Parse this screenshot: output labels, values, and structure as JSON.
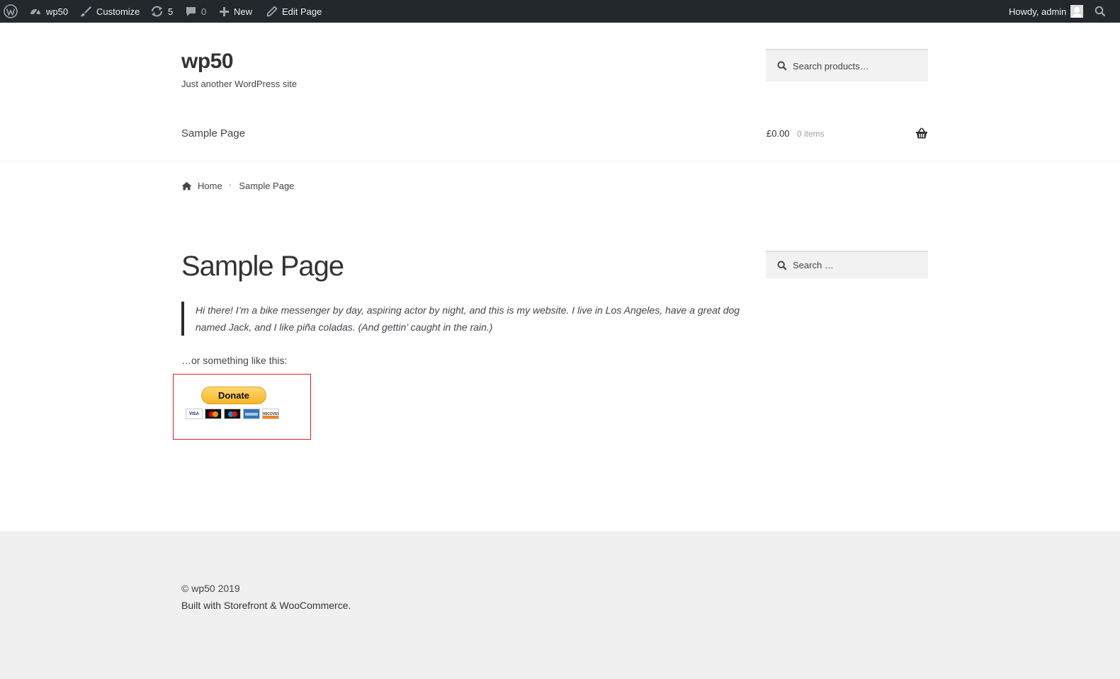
{
  "admin_bar": {
    "site_name": "wp50",
    "customize": "Customize",
    "updates_count": "5",
    "comments_count": "0",
    "new_label": "New",
    "edit_label": "Edit Page",
    "greeting": "Howdy, admin"
  },
  "header": {
    "site_title": "wp50",
    "tagline": "Just another WordPress site",
    "product_search_placeholder": "Search products…",
    "nav_item": "Sample Page",
    "cart_amount": "£0.00",
    "cart_items": "0 items"
  },
  "breadcrumb": {
    "home": "Home",
    "current": "Sample Page"
  },
  "main": {
    "title": "Sample Page",
    "quote": "Hi there! I’m a bike messenger by day, aspiring actor by night, and this is my website. I live in Los Angeles, have a great dog named Jack, and I like piña coladas. (And gettin’ caught in the rain.)",
    "paragraph": "…or something like this:",
    "donate_label": "Donate",
    "cards": [
      "VISA",
      "DISCOVER"
    ]
  },
  "sidebar": {
    "search_placeholder": "Search …"
  },
  "footer": {
    "copyright": "© wp50 2019",
    "built_with": "Built with Storefront & WooCommerce."
  },
  "colors": {
    "admin_bar_bg": "#23282d",
    "footer_bg": "#f0f0f0",
    "donate_yellow": "#ffc439",
    "highlight_red": "#e02020"
  },
  "icons": [
    "wordpress-logo-icon",
    "dashboard-icon",
    "brush-icon",
    "updates-icon",
    "comment-icon",
    "plus-icon",
    "pencil-icon",
    "search-icon",
    "basket-icon",
    "home-icon",
    "chevron-right-icon"
  ]
}
